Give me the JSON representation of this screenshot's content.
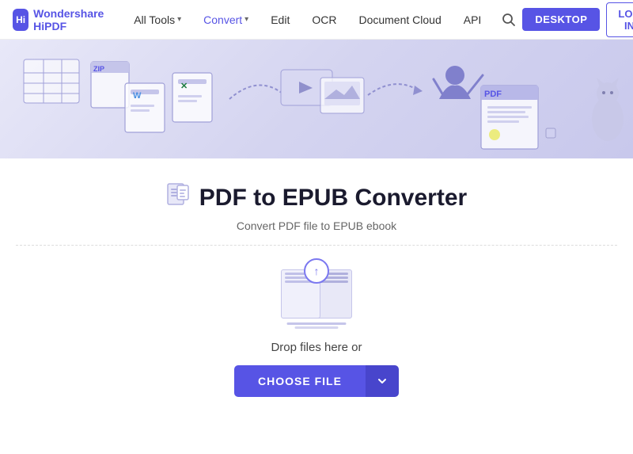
{
  "brand": {
    "name_part1": "Wondershare ",
    "name_part2": "HiPDF",
    "logo_letters": "Hi"
  },
  "nav": {
    "all_tools_label": "All Tools",
    "convert_label": "Convert",
    "edit_label": "Edit",
    "ocr_label": "OCR",
    "document_cloud_label": "Document Cloud",
    "api_label": "API",
    "desktop_label": "DESKTOP",
    "login_label": "LOG IN"
  },
  "converter": {
    "title": "PDF to EPUB Converter",
    "subtitle": "Convert PDF file to EPUB ebook",
    "title_icon": "📄"
  },
  "upload": {
    "drop_text": "Drop files here or",
    "choose_file_label": "CHOOSE FILE"
  },
  "colors": {
    "primary": "#5754e5",
    "primary_dark": "#4845cc",
    "primary_light": "#7b78f0",
    "bg_light": "#e8e8f8"
  }
}
